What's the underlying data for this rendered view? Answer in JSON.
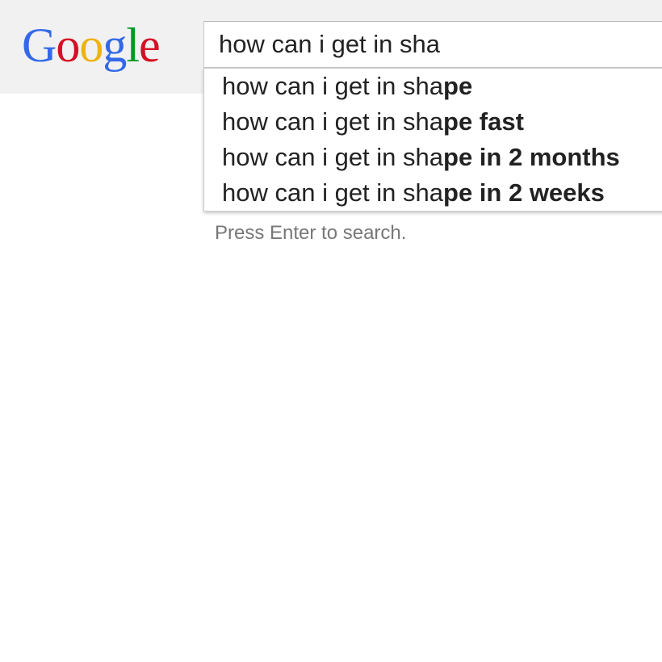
{
  "logo": {
    "letters": [
      {
        "char": "G",
        "color": "#3369e8"
      },
      {
        "char": "o",
        "color": "#d50f25"
      },
      {
        "char": "o",
        "color": "#eeb211"
      },
      {
        "char": "g",
        "color": "#3369e8"
      },
      {
        "char": "l",
        "color": "#009925"
      },
      {
        "char": "e",
        "color": "#d50f25"
      }
    ]
  },
  "search": {
    "value": "how can i get in sha"
  },
  "suggestions": [
    {
      "typed": "how can i get in sha",
      "completion": "pe"
    },
    {
      "typed": "how can i get in sha",
      "completion": "pe fast"
    },
    {
      "typed": "how can i get in sha",
      "completion": "pe in 2 months"
    },
    {
      "typed": "how can i get in sha",
      "completion": "pe in 2 weeks"
    }
  ],
  "hint": "Press Enter to search."
}
